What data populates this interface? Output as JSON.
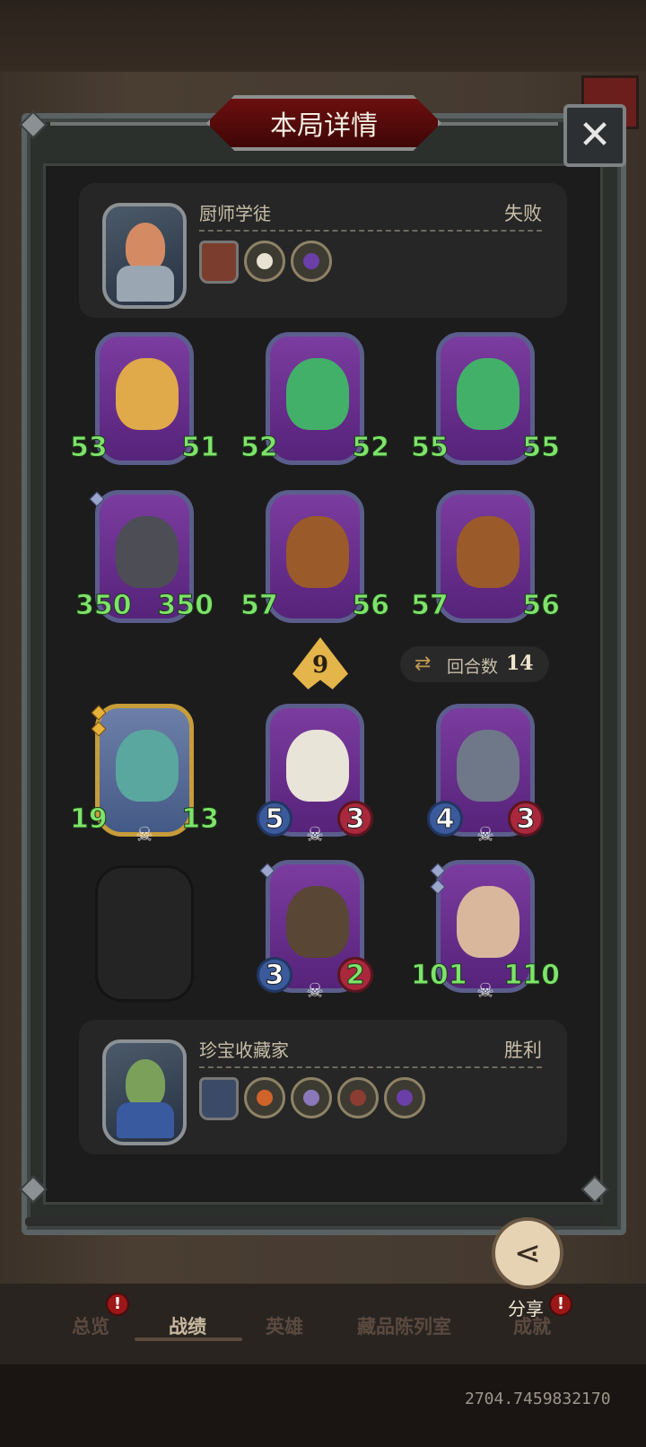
{
  "title": "本局详情",
  "close_icon": "close-icon",
  "top_player": {
    "name": "厨师学徒",
    "result": "失败",
    "items": [
      "hero-portrait-icon",
      "dice-item-icon",
      "purple-gem-icon"
    ]
  },
  "bottom_player": {
    "name": "珍宝收藏家",
    "result": "胜利",
    "items": [
      "hero-portrait-icon",
      "cauldron-item-icon",
      "drill-item-icon",
      "meat-item-icon",
      "purple-gem-icon"
    ]
  },
  "opponent_board": [
    {
      "name": "hamster",
      "attack": "53",
      "health": "51",
      "color": "#e0a94a"
    },
    {
      "name": "apple-frog",
      "attack": "52",
      "health": "52",
      "color": "#43b06a"
    },
    {
      "name": "apple-frog",
      "attack": "55",
      "health": "55",
      "color": "#43b06a"
    },
    {
      "name": "pirate-cat",
      "attack": "350",
      "health": "350",
      "color": "#4d4d55"
    },
    {
      "name": "deer",
      "attack": "57",
      "health": "56",
      "color": "#9a5a2a"
    },
    {
      "name": "deer",
      "attack": "57",
      "health": "56",
      "color": "#9a5a2a"
    }
  ],
  "player_board": [
    {
      "name": "fairy-dragon",
      "attack": "19",
      "health": "13",
      "color": "#5aa7a0"
    },
    {
      "name": "pelican",
      "attack": "5",
      "health": "3",
      "color": "#e9e4d8"
    },
    {
      "name": "bomb",
      "attack": "4",
      "health": "3",
      "color": "#6f7888"
    },
    {
      "name": "hooded-goblin",
      "attack": "3",
      "health": "2",
      "color": "#5a4634"
    },
    {
      "name": "scientist",
      "attack": "101",
      "health": "110",
      "color": "#d9b79c"
    }
  ],
  "tier": "9",
  "round": {
    "label": "回合数",
    "value": "14"
  },
  "share": {
    "label": "分享"
  },
  "nav": {
    "items": [
      "总览",
      "战绩",
      "英雄",
      "藏品陈列室",
      "成就"
    ],
    "active": "战绩"
  },
  "badges": [
    "!",
    "!"
  ],
  "footer_number": "2704.7459832170"
}
